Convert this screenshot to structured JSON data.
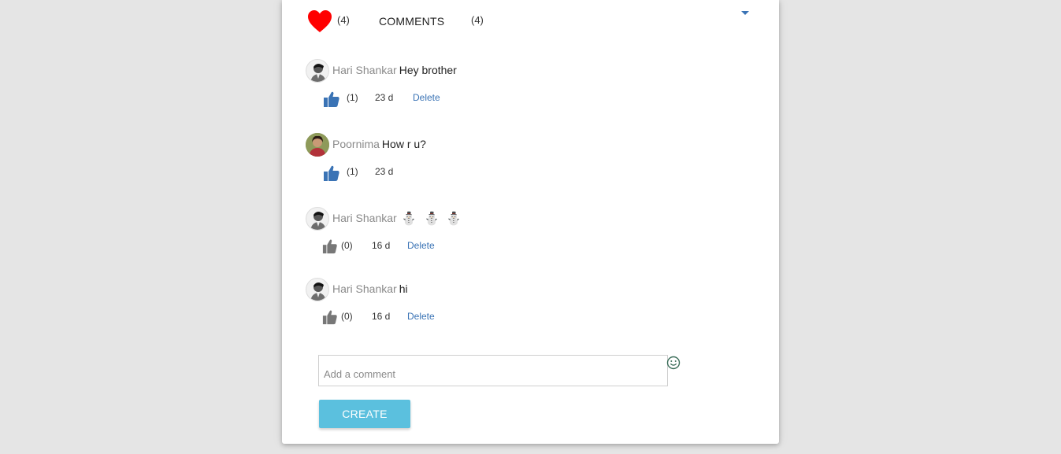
{
  "summary": {
    "likes_count": "(4)",
    "comments_label": "COMMENTS",
    "comments_count": "(4)"
  },
  "comments": [
    {
      "author": "Hari Shankar",
      "text": "Hey brother",
      "likes": "(1)",
      "liked": true,
      "age": "23 d",
      "delete_label": "Delete"
    },
    {
      "author": "Poornima",
      "text": "How r u?",
      "likes": "(1)",
      "liked": true,
      "age": "23 d"
    },
    {
      "author": "Hari Shankar",
      "text": "",
      "emoji": [
        "⛄",
        "⛄",
        "⛄"
      ],
      "likes": "(0)",
      "liked": false,
      "age": "16 d",
      "delete_label": "Delete"
    },
    {
      "author": "Hari Shankar",
      "text": "hi",
      "likes": "(0)",
      "liked": false,
      "age": "16 d",
      "delete_label": "Delete"
    }
  ],
  "composer": {
    "placeholder": "Add a comment",
    "submit_label": "CREATE"
  },
  "colors": {
    "heart": "#ff0000",
    "like_active": "#3a73b5",
    "like_inactive": "#777777",
    "button": "#5bc0de",
    "link": "#3a73b5"
  }
}
